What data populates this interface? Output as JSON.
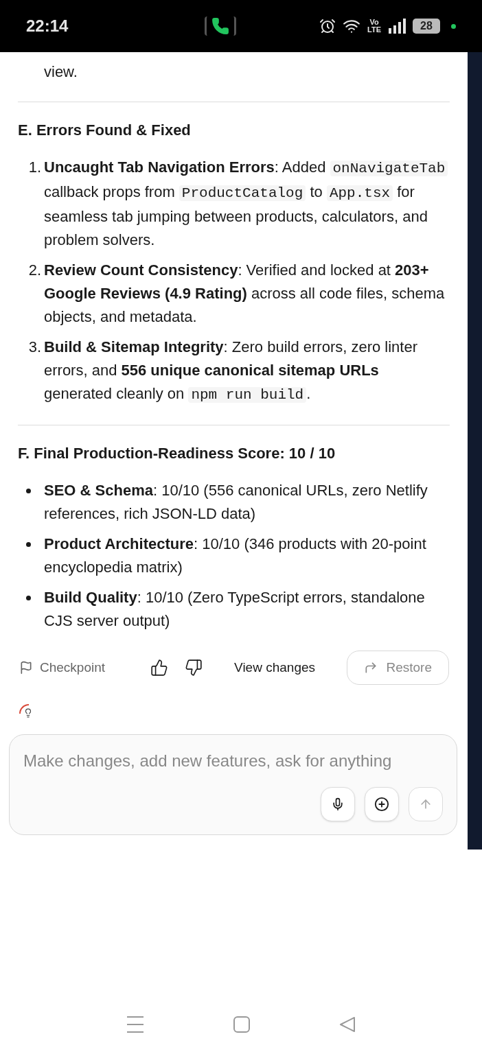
{
  "status_bar": {
    "time": "22:14",
    "battery": "28",
    "network_top": "Vo",
    "network_bottom": "LTE"
  },
  "intro_tail": "view.",
  "sections": [
    {
      "heading": "E. Errors Found & Fixed",
      "kind": "numbered",
      "items": [
        {
          "marker": "1.",
          "segments": [
            {
              "kind": "bold",
              "text": "Uncaught Tab Navigation Errors"
            },
            {
              "kind": "plain",
              "text": ": Added "
            },
            {
              "kind": "code",
              "text": "onNavigateTab"
            },
            {
              "kind": "plain",
              "text": " callback props from "
            },
            {
              "kind": "code",
              "text": "ProductCatalog"
            },
            {
              "kind": "plain",
              "text": " to "
            },
            {
              "kind": "code",
              "text": "App.tsx"
            },
            {
              "kind": "plain",
              "text": " for seamless tab jumping between products, calculators, and problem solvers."
            }
          ]
        },
        {
          "marker": "2.",
          "segments": [
            {
              "kind": "bold",
              "text": "Review Count Consistency"
            },
            {
              "kind": "plain",
              "text": ": Verified and locked at "
            },
            {
              "kind": "bold",
              "text": "203+ Google Reviews (4.9 Rating)"
            },
            {
              "kind": "plain",
              "text": " across all code files, schema objects, and metadata."
            }
          ]
        },
        {
          "marker": "3.",
          "segments": [
            {
              "kind": "bold",
              "text": "Build & Sitemap Integrity"
            },
            {
              "kind": "plain",
              "text": ": Zero build errors, zero linter errors, and "
            },
            {
              "kind": "bold",
              "text": "556 unique canonical sitemap URLs"
            },
            {
              "kind": "plain",
              "text": " generated cleanly on "
            },
            {
              "kind": "code",
              "text": "npm run build"
            },
            {
              "kind": "plain",
              "text": "."
            }
          ]
        }
      ]
    },
    {
      "heading": "F. Final Production-Readiness Score: 10 / 10",
      "kind": "bulleted",
      "items": [
        {
          "segments": [
            {
              "kind": "bold",
              "text": "SEO & Schema"
            },
            {
              "kind": "plain",
              "text": ": 10/10 (556 canonical URLs, zero Netlify references, rich JSON-LD data)"
            }
          ]
        },
        {
          "segments": [
            {
              "kind": "bold",
              "text": "Product Architecture"
            },
            {
              "kind": "plain",
              "text": ": 10/10 (346 products with 20-point encyclopedia matrix)"
            }
          ]
        },
        {
          "segments": [
            {
              "kind": "bold",
              "text": "Build Quality"
            },
            {
              "kind": "plain",
              "text": ": 10/10 (Zero TypeScript errors, standalone CJS server output)"
            }
          ]
        }
      ]
    }
  ],
  "actions": {
    "checkpoint": "Checkpoint",
    "view_changes": "View changes",
    "restore": "Restore"
  },
  "composer": {
    "placeholder": "Make changes, add new features, ask for anything"
  }
}
